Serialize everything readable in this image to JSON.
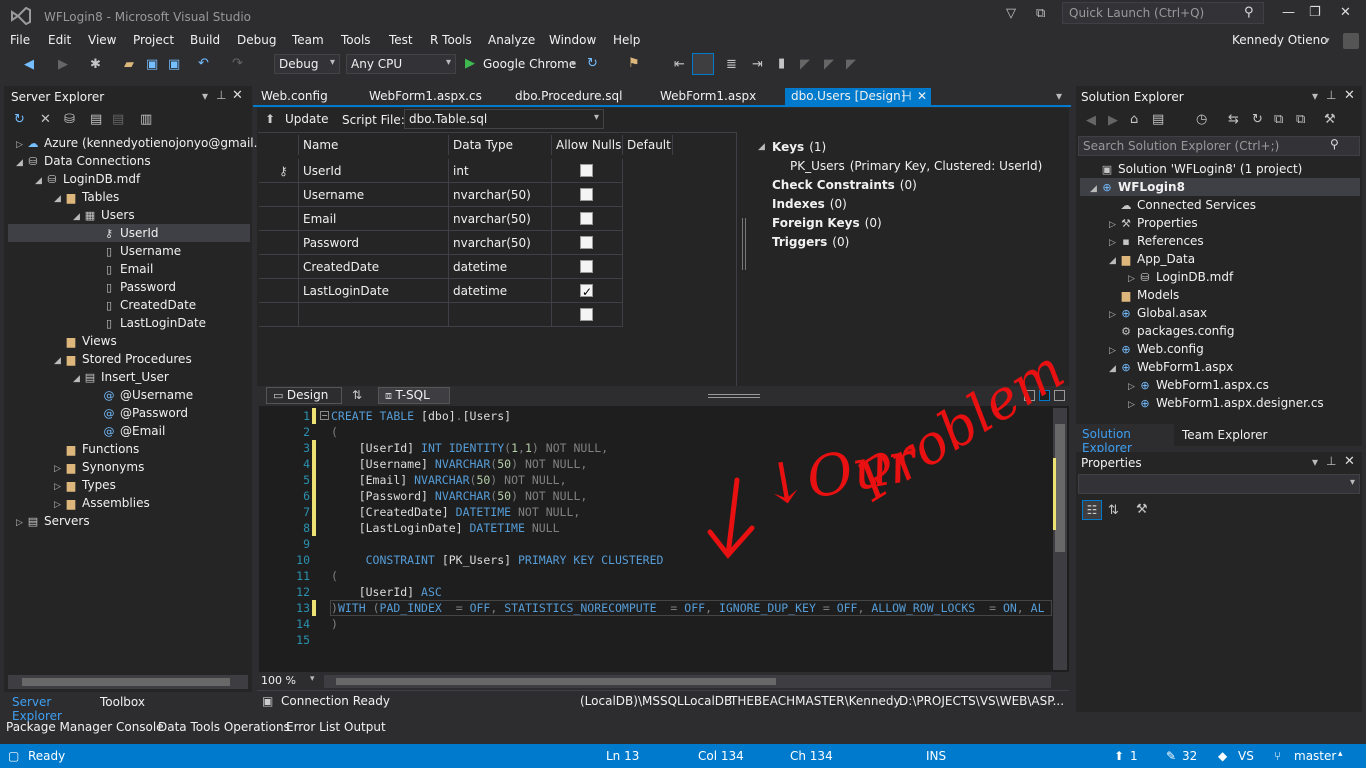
{
  "window": {
    "title": "WFLogin8 - Microsoft Visual Studio",
    "quick_launch": "Quick Launch (Ctrl+Q)",
    "user": "Kennedy Otieno"
  },
  "menu": [
    "File",
    "Edit",
    "View",
    "Project",
    "Build",
    "Debug",
    "Team",
    "Tools",
    "Test",
    "R Tools",
    "Analyze",
    "Window",
    "Help"
  ],
  "toolbar": {
    "config": "Debug",
    "platform": "Any CPU",
    "run": "Google Chrome"
  },
  "server_explorer": {
    "title": "Server Explorer",
    "items": [
      {
        "label": "Azure (kennedyotienojonyo@gmail.",
        "level": 0,
        "arrow": "▷",
        "icon": "cloud-icon"
      },
      {
        "label": "Data Connections",
        "level": 0,
        "arrow": "◢",
        "icon": "db-icon"
      },
      {
        "label": "LoginDB.mdf",
        "level": 1,
        "arrow": "◢",
        "icon": "db-icon"
      },
      {
        "label": "Tables",
        "level": 2,
        "arrow": "◢",
        "icon": "folder-icon"
      },
      {
        "label": "Users",
        "level": 3,
        "arrow": "◢",
        "icon": "table-icon"
      },
      {
        "label": "UserId",
        "level": 4,
        "arrow": "",
        "icon": "key-icon"
      },
      {
        "label": "Username",
        "level": 4,
        "arrow": "",
        "icon": "column-icon"
      },
      {
        "label": "Email",
        "level": 4,
        "arrow": "",
        "icon": "column-icon"
      },
      {
        "label": "Password",
        "level": 4,
        "arrow": "",
        "icon": "column-icon"
      },
      {
        "label": "CreatedDate",
        "level": 4,
        "arrow": "",
        "icon": "column-icon"
      },
      {
        "label": "LastLoginDate",
        "level": 4,
        "arrow": "",
        "icon": "column-icon"
      },
      {
        "label": "Views",
        "level": 2,
        "arrow": "",
        "icon": "folder-icon"
      },
      {
        "label": "Stored Procedures",
        "level": 2,
        "arrow": "◢",
        "icon": "folder-icon"
      },
      {
        "label": "Insert_User",
        "level": 3,
        "arrow": "◢",
        "icon": "proc-icon"
      },
      {
        "label": "@Username",
        "level": 4,
        "arrow": "",
        "icon": "param-icon"
      },
      {
        "label": "@Password",
        "level": 4,
        "arrow": "",
        "icon": "param-icon"
      },
      {
        "label": "@Email",
        "level": 4,
        "arrow": "",
        "icon": "param-icon"
      },
      {
        "label": "Functions",
        "level": 2,
        "arrow": "",
        "icon": "folder-icon"
      },
      {
        "label": "Synonyms",
        "level": 2,
        "arrow": "▷",
        "icon": "folder-icon"
      },
      {
        "label": "Types",
        "level": 2,
        "arrow": "▷",
        "icon": "folder-icon"
      },
      {
        "label": "Assemblies",
        "level": 2,
        "arrow": "▷",
        "icon": "folder-icon"
      },
      {
        "label": "Servers",
        "level": 0,
        "arrow": "▷",
        "icon": "server-icon"
      }
    ],
    "tabs": [
      "Server Explorer",
      "Toolbox"
    ]
  },
  "doc_tabs": [
    "Web.config",
    "WebForm1.aspx.cs",
    "dbo.Procedure.sql",
    "WebForm1.aspx",
    "dbo.Users [Design]"
  ],
  "designer": {
    "update": "Update",
    "script_file_label": "Script File:",
    "script_file": "dbo.Table.sql",
    "columns": [
      "Name",
      "Data Type",
      "Allow Nulls",
      "Default"
    ],
    "rows": [
      {
        "name": "UserId",
        "type": "int",
        "nulls": false,
        "key": true
      },
      {
        "name": "Username",
        "type": "nvarchar(50)",
        "nulls": false
      },
      {
        "name": "Email",
        "type": "nvarchar(50)",
        "nulls": false
      },
      {
        "name": "Password",
        "type": "nvarchar(50)",
        "nulls": false
      },
      {
        "name": "CreatedDate",
        "type": "datetime",
        "nulls": false
      },
      {
        "name": "LastLoginDate",
        "type": "datetime",
        "nulls": true
      },
      {
        "name": "",
        "type": "",
        "nulls": false
      }
    ],
    "props": [
      {
        "label": "Keys",
        "count": "(1)"
      },
      {
        "label": "PK_Users",
        "count": "(Primary Key, Clustered: UserId)",
        "sub": true
      },
      {
        "label": "Check Constraints",
        "count": "(0)"
      },
      {
        "label": "Indexes",
        "count": "(0)"
      },
      {
        "label": "Foreign Keys",
        "count": "(0)"
      },
      {
        "label": "Triggers",
        "count": "(0)"
      }
    ],
    "pane_tabs": [
      "Design",
      "T-SQL"
    ]
  },
  "code": {
    "lines": [
      "CREATE TABLE [dbo].[Users]",
      "(",
      "    [UserId] INT IDENTITY(1,1) NOT NULL,",
      "    [Username] NVARCHAR(50) NOT NULL,",
      "    [Email] NVARCHAR(50) NOT NULL,",
      "    [Password] NVARCHAR(50) NOT NULL,",
      "    [CreatedDate] DATETIME NOT NULL,",
      "    [LastLoginDate] DATETIME NULL",
      "",
      "     CONSTRAINT [PK_Users] PRIMARY KEY CLUSTERED",
      "(",
      "    [UserId] ASC",
      ")WITH (PAD_INDEX  = OFF, STATISTICS_NORECOMPUTE  = OFF, IGNORE_DUP_KEY = OFF, ALLOW_ROW_LOCKS  = ON, AL",
      ")",
      ""
    ],
    "zoom": "100 %",
    "annotation_1": "↓Our",
    "annotation_2": "Problem"
  },
  "conn_status": {
    "ready": "Connection Ready",
    "server": "(LocalDB)\\MSSQLLocalDB",
    "user": "THEBEACHMASTER\\Kennedy",
    "path": "D:\\PROJECTS\\VS\\WEB\\ASP..."
  },
  "solution_explorer": {
    "title": "Solution Explorer",
    "search": "Search Solution Explorer (Ctrl+;)",
    "items": [
      {
        "label": "Solution 'WFLogin8' (1 project)",
        "level": 0,
        "arrow": ""
      },
      {
        "label": "WFLogin8",
        "level": 0,
        "arrow": "◢",
        "bold": true
      },
      {
        "label": "Connected Services",
        "level": 1,
        "arrow": ""
      },
      {
        "label": "Properties",
        "level": 1,
        "arrow": "▷"
      },
      {
        "label": "References",
        "level": 1,
        "arrow": "▷"
      },
      {
        "label": "App_Data",
        "level": 1,
        "arrow": "◢"
      },
      {
        "label": "LoginDB.mdf",
        "level": 2,
        "arrow": "▷"
      },
      {
        "label": "Models",
        "level": 1,
        "arrow": ""
      },
      {
        "label": "Global.asax",
        "level": 1,
        "arrow": "▷"
      },
      {
        "label": "packages.config",
        "level": 1,
        "arrow": ""
      },
      {
        "label": "Web.config",
        "level": 1,
        "arrow": "▷"
      },
      {
        "label": "WebForm1.aspx",
        "level": 1,
        "arrow": "◢"
      },
      {
        "label": "WebForm1.aspx.cs",
        "level": 2,
        "arrow": "▷"
      },
      {
        "label": "WebForm1.aspx.designer.cs",
        "level": 2,
        "arrow": "▷"
      }
    ],
    "tabs": [
      "Solution Explorer",
      "Team Explorer"
    ]
  },
  "properties": {
    "title": "Properties"
  },
  "bottom_tabs": [
    "Package Manager Console",
    "Data Tools Operations",
    "Error List",
    "Output"
  ],
  "status": {
    "ready": "Ready",
    "ln": "Ln 13",
    "col": "Col 134",
    "ch": "Ch 134",
    "ins": "INS",
    "up": "1",
    "edits": "32",
    "repo": "VS",
    "branch": "master"
  },
  "colors": {
    "accent": "#007acc",
    "annotation": "#e81010"
  }
}
